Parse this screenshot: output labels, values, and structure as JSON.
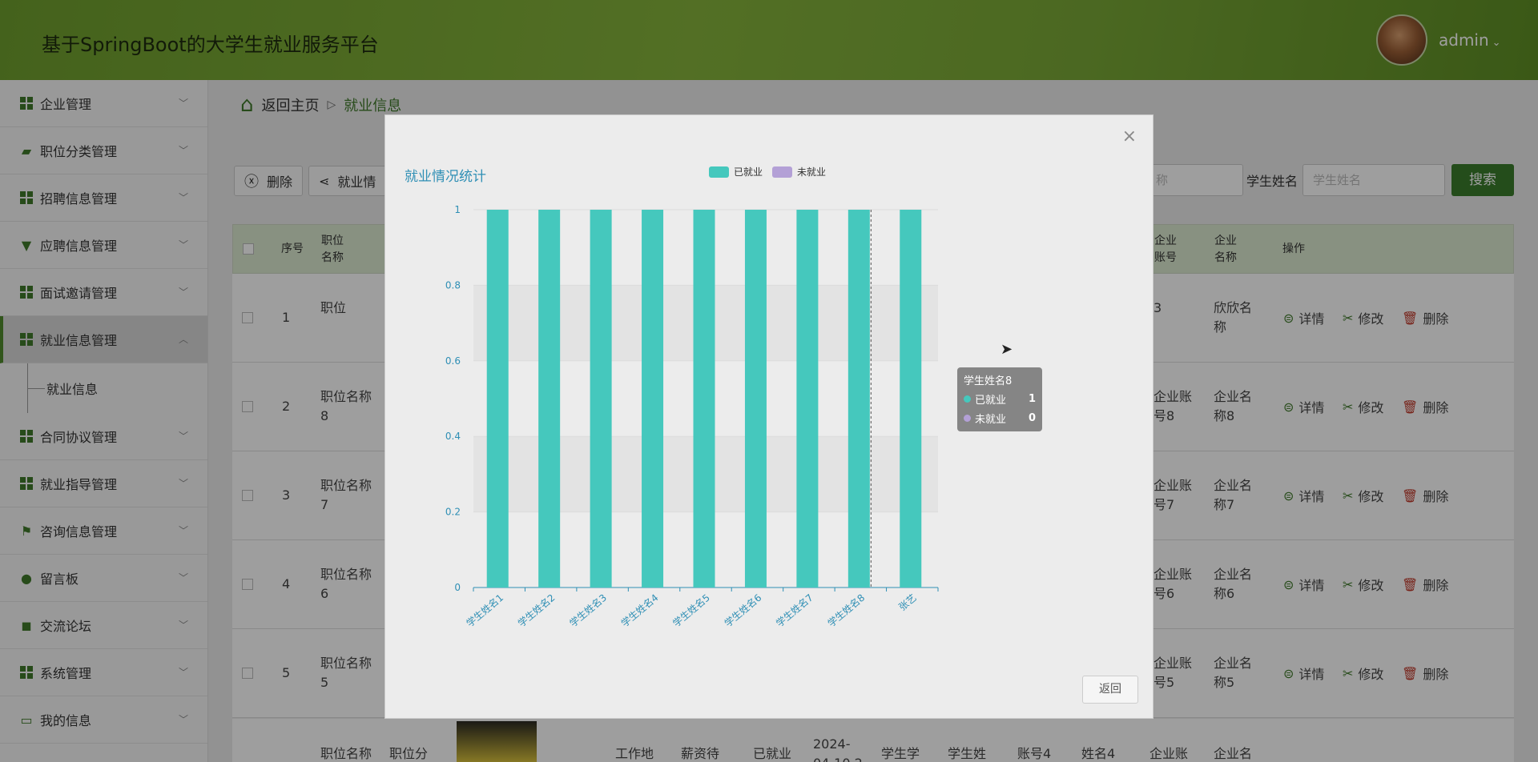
{
  "header": {
    "title": "基于SpringBoot的大学生就业服务平台",
    "user": "admin"
  },
  "sidebar": {
    "items": [
      {
        "label": "企业管理",
        "icon": "grid-icon"
      },
      {
        "label": "职位分类管理",
        "icon": "briefcase-icon"
      },
      {
        "label": "招聘信息管理",
        "icon": "grid-icon"
      },
      {
        "label": "应聘信息管理",
        "icon": "stamp-icon"
      },
      {
        "label": "面试邀请管理",
        "icon": "grid-icon"
      },
      {
        "label": "就业信息管理",
        "icon": "grid-icon"
      },
      {
        "label": "合同协议管理",
        "icon": "grid-icon"
      },
      {
        "label": "就业指导管理",
        "icon": "grid-icon"
      },
      {
        "label": "咨询信息管理",
        "icon": "flag-icon"
      },
      {
        "label": "留言板",
        "icon": "person-icon"
      },
      {
        "label": "交流论坛",
        "icon": "chat-icon"
      },
      {
        "label": "系统管理",
        "icon": "grid-icon"
      },
      {
        "label": "我的信息",
        "icon": "card-icon"
      }
    ],
    "submenu_label": "就业信息"
  },
  "breadcrumb": {
    "home": "返回主页",
    "current": "就业信息"
  },
  "toolbar": {
    "delete": "删除",
    "stats": "就业情"
  },
  "search": {
    "label": "学生姓名",
    "placeholder": "学生姓名",
    "prev_placeholder": "称",
    "button": "搜索"
  },
  "table": {
    "headers": {
      "index": "序号",
      "position_name": "职位名称",
      "company_account": "企业账号",
      "company_name": "企业名称",
      "actions": "操作"
    },
    "rows": [
      {
        "index": "1",
        "position": "职位",
        "account": "3",
        "company": "欣欣名称"
      },
      {
        "index": "2",
        "position": "职位名称8",
        "account": "企业账号8",
        "company": "企业名称8"
      },
      {
        "index": "3",
        "position": "职位名称7",
        "account": "企业账号7",
        "company": "企业名称7"
      },
      {
        "index": "4",
        "position": "职位名称6",
        "account": "企业账号6",
        "company": "企业名称6"
      },
      {
        "index": "5",
        "position": "职位名称5",
        "account": "企业账号5",
        "company": "企业名称5"
      }
    ],
    "partial_row": {
      "position": "职位名称",
      "category": "职位分",
      "location": "工作地",
      "salary": "薪资待",
      "status": "已就业",
      "date": "2024-04-10 2",
      "student_no": "学生学",
      "student_name": "学生姓",
      "account4": "账号4",
      "name4": "姓名4",
      "account": "企业账",
      "company": "企业名"
    },
    "actions": {
      "detail": "详情",
      "edit": "修改",
      "delete": "删除"
    }
  },
  "modal": {
    "close": "×",
    "return_button": "返回"
  },
  "chart_data": {
    "type": "bar",
    "title": "就业情况统计",
    "categories": [
      "学生姓名1",
      "学生姓名2",
      "学生姓名3",
      "学生姓名4",
      "学生姓名5",
      "学生姓名6",
      "学生姓名7",
      "学生姓名8",
      "张艺"
    ],
    "series": [
      {
        "name": "已就业",
        "color": "#45c8bd",
        "values": [
          1,
          1,
          1,
          1,
          1,
          1,
          1,
          1,
          1
        ]
      },
      {
        "name": "未就业",
        "color": "#b3a0d6",
        "values": [
          0,
          0,
          0,
          0,
          0,
          0,
          0,
          0,
          0
        ]
      }
    ],
    "ylim": [
      0,
      1
    ],
    "yticks": [
      "0",
      "0.2",
      "0.4",
      "0.6",
      "0.8",
      "1"
    ],
    "legend_position": "top-center",
    "tooltip": {
      "category": "学生姓名8",
      "rows": [
        {
          "name": "已就业",
          "value": "1"
        },
        {
          "name": "未就业",
          "value": "0"
        }
      ]
    }
  },
  "colors": {
    "accent": "#3b7d2d",
    "chart_axis": "#2f8fb5"
  }
}
